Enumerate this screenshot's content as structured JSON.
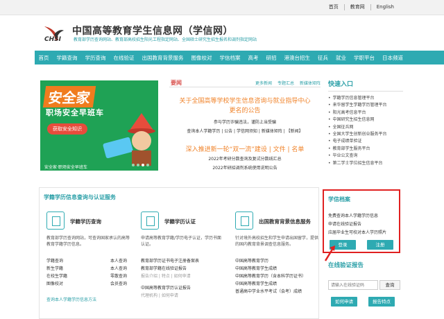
{
  "top_links": [
    "首页",
    "教育网",
    "English"
  ],
  "logo": {
    "text": "CHSI"
  },
  "site": {
    "title": "中国高等教育学生信息网（学信网）",
    "subtitle": "教育部学历查询网站、教育部高校招生阳光工程指定网站、全国硕士研究生招生报名和调剂指定网站"
  },
  "nav": [
    "首页",
    "学籍查询",
    "学历查询",
    "在线验证",
    "出国教育背景服务",
    "图像校对",
    "学信档案",
    "高考",
    "研招",
    "港澳台招生",
    "征兵",
    "就业",
    "学职平台",
    "日本频道"
  ],
  "banner": {
    "title": "安全家",
    "subtitle": "职场安全早班车",
    "cta": "获取安全知识",
    "footer": "安全家·职场安全早班车"
  },
  "news": {
    "heading": "要闻",
    "more_links": [
      "更多新闻",
      "专题汇总",
      "新媒体矩阵"
    ],
    "headline1": "关于全国高等学校学生信息咨询与就业指导中心",
    "headline1b": "更名的公告",
    "line1": "参与学历诈骗违法，谨防上当受骗",
    "line2": "查询本人学籍学历 | 公告 | 学信网须知 | 新媒体矩阵 | 【新闻】",
    "headline2": "深入推进新一轮“双一流”建设 | 文件 | 名单",
    "line3": "2022年考研分数查询及复试分数线汇总",
    "line4": "2022年研招调剂系统使用说明公告"
  },
  "quick": {
    "heading": "快速入口",
    "items": [
      "学籍学历信息管理平台",
      "来华留学生学籍学历管理平台",
      "阳光高考信息平台",
      "中国研究生招生信息网",
      "全国征兵网",
      "全国大学生创新创业服务平台",
      "电子成绩单验证",
      "教育部学生服务平台",
      "毕业公文查询",
      "第二学士学位招生信息平台"
    ]
  },
  "service": {
    "heading": "学籍学历信息查询与认证服务",
    "col1": {
      "title": "学籍学历查询",
      "desc": "教育部学历查询网站，可查询国家承认的高等教育学籍学历信息。",
      "items": [
        [
          "学籍查询",
          "本人查询"
        ],
        [
          "新生学籍",
          "本人查询"
        ],
        [
          "在校生学籍",
          "零散查询"
        ],
        [
          "图像校对",
          "会员查询"
        ]
      ],
      "link": "查询本人学籍学历信息方法"
    },
    "col2": {
      "title": "学籍学历认证",
      "desc": "申请高等教育学籍/学历电子认证，学历书面认证。",
      "items": [
        "教育部学历证书电子注册备案表",
        "教育部学籍在线验证报告"
      ],
      "sub1": "报告介绍 | 特点 | 如何申请",
      "items2": [
        "中国高等教育学历认证报告"
      ],
      "sub2": "代理机构 | 如何申请"
    },
    "col3": {
      "title": "出国教育背景信息服务",
      "desc": "针对境外高校招生和学生申请出国留学，提供的国内教育背景调查信息服务。",
      "items": [
        "中国高等教育学历",
        "中国高等教育学生成绩",
        "中国高等教育学历（含本科学历证书）",
        "中国高等教育学生成绩",
        "普通高中学业水平考试（会考）成绩"
      ]
    }
  },
  "xuexin": {
    "heading": "学信档案",
    "lines": [
      "免费查询本人学籍学历信息",
      "申请在线验证报告",
      "应届毕业生可校对本人学历照片"
    ],
    "login": "登录",
    "register": "注册"
  },
  "report": {
    "heading": "在线验证报告",
    "placeholder": "请输入在线验证码",
    "query": "查询",
    "apply": "如何申请",
    "feature": "报告特点"
  },
  "colors": {
    "accent": "#2eaab2",
    "headline": "#f0832a",
    "highlight_box": "#e02020",
    "banner_bg": "#1fa255"
  }
}
